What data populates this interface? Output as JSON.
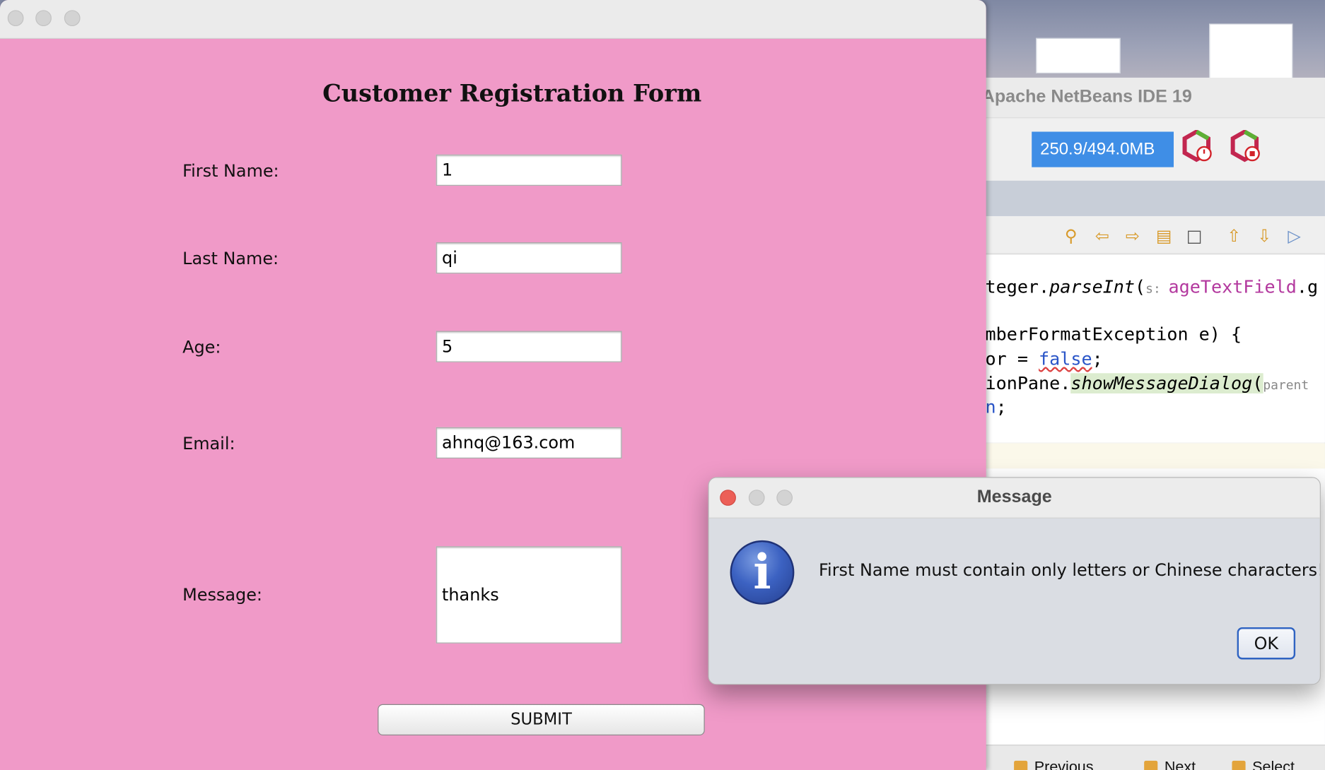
{
  "ide": {
    "title": "Apache NetBeans IDE 19",
    "memory": "250.9/494.0MB",
    "code_lines": [
      [
        "teger.",
        "parseInt",
        "(",
        "s: ",
        "ageTextField",
        ".g"
      ],
      [
        "mberFormatException e) {"
      ],
      [
        "or = ",
        "false",
        ";"
      ],
      [
        "ionPane.",
        "showMessageDialog",
        "(",
        "parent"
      ],
      [
        "n",
        ";"
      ]
    ],
    "bottom_buttons": [
      "Previous",
      "Next",
      "Select"
    ]
  },
  "form": {
    "heading": "Customer Registration Form",
    "fields": [
      {
        "label": "First Name:",
        "value": "1"
      },
      {
        "label": "Last Name:",
        "value": "qi"
      },
      {
        "label": "Age:",
        "value": "5"
      },
      {
        "label": "Email:",
        "value": "ahnq@163.com"
      }
    ],
    "message_label": "Message:",
    "message_value": "thanks",
    "submit_label": "SUBMIT"
  },
  "dialog": {
    "title": "Message",
    "icon": "info-icon",
    "text": "First Name must contain only letters or Chinese characters!",
    "ok_label": "OK"
  },
  "colors": {
    "form_bg": "#f09ac8",
    "memory_bar": "#3f8ee6",
    "close_red": "#ec5f57",
    "ok_border": "#2f63c2"
  }
}
